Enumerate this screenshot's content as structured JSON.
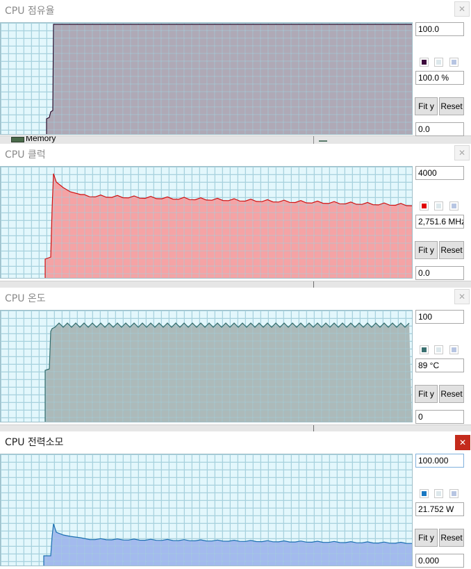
{
  "background_window": {
    "memory_label": "Memory"
  },
  "panels": [
    {
      "title": "CPU 점유율",
      "close_glyph": "✕",
      "max_value": "100.0",
      "current_value": "100.0 %",
      "min_value": "0.0",
      "fit_label": "Fit y",
      "reset_label": "Reset",
      "line_color": "#2a0a2a",
      "fill_color": "#a8a0ae",
      "swatches": [
        "#3d0a3d",
        "#dde8ec",
        "#b7c5e2"
      ]
    },
    {
      "title": "CPU 클럭",
      "close_glyph": "✕",
      "max_value": "4000",
      "current_value": "2,751.6 MHz",
      "min_value": "0.0",
      "fit_label": "Fit y",
      "reset_label": "Reset",
      "line_color": "#d01010",
      "fill_color": "#f6999b",
      "swatches": [
        "#e00000",
        "#dde8ec",
        "#b7c5e2"
      ]
    },
    {
      "title": "CPU 온도",
      "close_glyph": "✕",
      "max_value": "100",
      "current_value": "89 °C",
      "min_value": "0",
      "fit_label": "Fit y",
      "reset_label": "Reset",
      "line_color": "#2f6c6c",
      "fill_color": "#a5b3b3",
      "swatches": [
        "#3a7070",
        "#dde8ec",
        "#b7c5e2"
      ]
    },
    {
      "title": "CPU 전력소모",
      "close_glyph": "✕",
      "max_value": "100.000",
      "current_value": "21.752 W",
      "min_value": "0.000",
      "fit_label": "Fit y",
      "reset_label": "Reset",
      "line_color": "#1a6fb0",
      "fill_color": "#9bb3ec",
      "swatches": [
        "#1a78c2",
        "#dde8ec",
        "#b7c5e2"
      ]
    }
  ]
}
